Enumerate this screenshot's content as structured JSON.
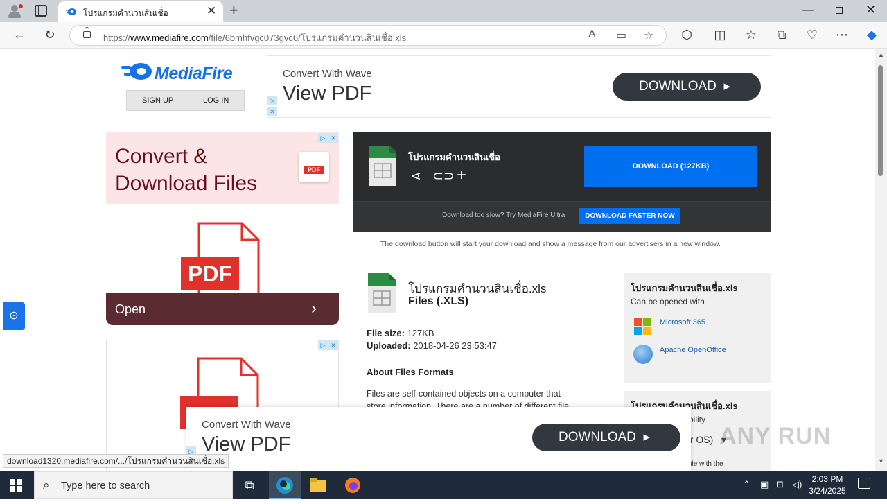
{
  "browser": {
    "tab_title": "โปรแกรมคำนวนสินเชื่อ",
    "url_prefix": "https://",
    "url_host": "www.mediafire.com",
    "url_path": "/file/6bmhfvgc073gvc6/โปรแกรมคำนวนสินเชื่อ.xls",
    "status_url": "download1320.mediafire.com/.../โปรแกรมคำนวนสินเชื่อ.xls"
  },
  "header": {
    "logo": "MediaFire",
    "sign_up": "SIGN UP",
    "log_in": "LOG IN"
  },
  "ads": {
    "top_small": "Convert With Wave",
    "top_big": "View PDF",
    "top_button": "DOWNLOAD",
    "left_line1": "Convert &",
    "left_line2": "Download Files",
    "pdf_label": "PDF",
    "open_label": "Open",
    "bottom_small": "Convert With Wave",
    "bottom_big": "View PDF",
    "bottom_button": "DOWNLOAD"
  },
  "download": {
    "file_name": "โปรแกรมคำนวนสินเชื่อ",
    "button": "DOWNLOAD (127KB)",
    "slow_text": "Download too slow? Try MediaFire Ultra",
    "faster_button": "DOWNLOAD FASTER NOW",
    "notice": "The download button will start your download and show a message from our advertisers in a new window."
  },
  "file_info": {
    "title": "โปรแกรมคำนวนสินเชื่อ.xls",
    "type": "Files (.XLS)",
    "size_label": "File size:",
    "size": "127KB",
    "uploaded_label": "Uploaded:",
    "uploaded": "2018-04-26 23:53:47",
    "about_heading": "About Files Formats",
    "about_text": "Files are self-contained objects on a computer that store information. There are a number of different file"
  },
  "sidebar": {
    "box1_title": "โปรแกรมคำนวนสินเชื่อ.xls",
    "box1_sub": "Can be opened with",
    "apps": [
      "Microsoft 365",
      "Apache OpenOffice"
    ],
    "box2_title": "โปรแกรมคำนวนสินเชื่อ.xls",
    "box2_sub": "tibility",
    "box2_os": "ur OS)",
    "box2_comp": "tible with the"
  },
  "watermark": "ANY RUN",
  "taskbar": {
    "search_placeholder": "Type here to search",
    "time": "2:03 PM",
    "date": "3/24/2025"
  },
  "colors": {
    "accent": "#0070f0",
    "brand": "#1673e6",
    "dark_box": "#2b2c2e",
    "ad_button": "#31383f"
  }
}
